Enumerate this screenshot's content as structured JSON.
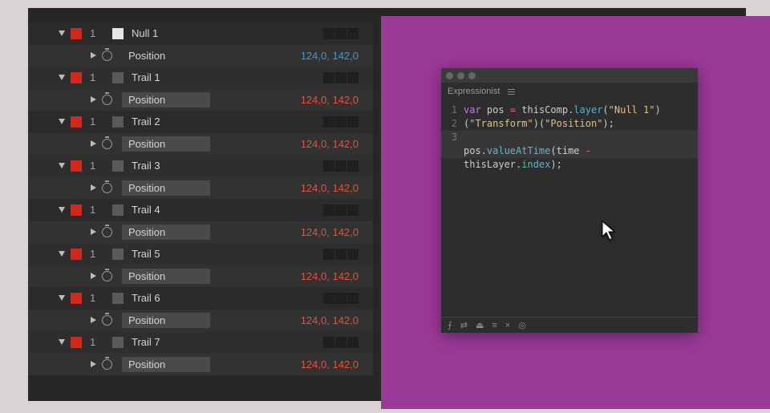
{
  "timeline": {
    "layers": [
      {
        "index": "1",
        "name": "Null 1",
        "null": true,
        "prop": "Position",
        "value": "124,0, 142,0",
        "highlighted": false,
        "valueColor": "blue"
      },
      {
        "index": "1",
        "name": "Trail 1",
        "null": false,
        "prop": "Position",
        "value": "124,0, 142,0",
        "highlighted": true,
        "valueColor": "red"
      },
      {
        "index": "1",
        "name": "Trail 2",
        "null": false,
        "prop": "Position",
        "value": "124,0, 142,0",
        "highlighted": true,
        "valueColor": "red"
      },
      {
        "index": "1",
        "name": "Trail 3",
        "null": false,
        "prop": "Position",
        "value": "124,0, 142,0",
        "highlighted": true,
        "valueColor": "red"
      },
      {
        "index": "1",
        "name": "Trail 4",
        "null": false,
        "prop": "Position",
        "value": "124,0, 142,0",
        "highlighted": true,
        "valueColor": "red"
      },
      {
        "index": "1",
        "name": "Trail 5",
        "null": false,
        "prop": "Position",
        "value": "124,0, 142,0",
        "highlighted": true,
        "valueColor": "red"
      },
      {
        "index": "1",
        "name": "Trail 6",
        "null": false,
        "prop": "Position",
        "value": "124,0, 142,0",
        "highlighted": true,
        "valueColor": "red"
      },
      {
        "index": "1",
        "name": "Trail 7",
        "null": false,
        "prop": "Position",
        "value": "124,0, 142,0",
        "highlighted": true,
        "valueColor": "red"
      }
    ]
  },
  "editor": {
    "title": "Expressionist",
    "lines": [
      "1",
      "2",
      "3"
    ],
    "code": {
      "l1a": "var",
      "l1b": " pos ",
      "l1c": "=",
      "l1d": " thisComp.",
      "l1e": "layer",
      "l1f": "(",
      "l1g": "\"Null 1\"",
      "l1h": ")",
      "l1i": "(",
      "l1j": "\"Transform\"",
      "l1k": ")(",
      "l1l": "\"Position\"",
      "l1m": ");",
      "l3a": "pos.",
      "l3b": "valueAtTime",
      "l3c": "(time ",
      "l3d": "-",
      "l3e": "thisLayer.",
      "l3f": "index",
      "l3g": ");"
    },
    "status_icons": [
      "⨍",
      "⇄",
      "⏏",
      "≡",
      "×",
      "◎"
    ]
  }
}
